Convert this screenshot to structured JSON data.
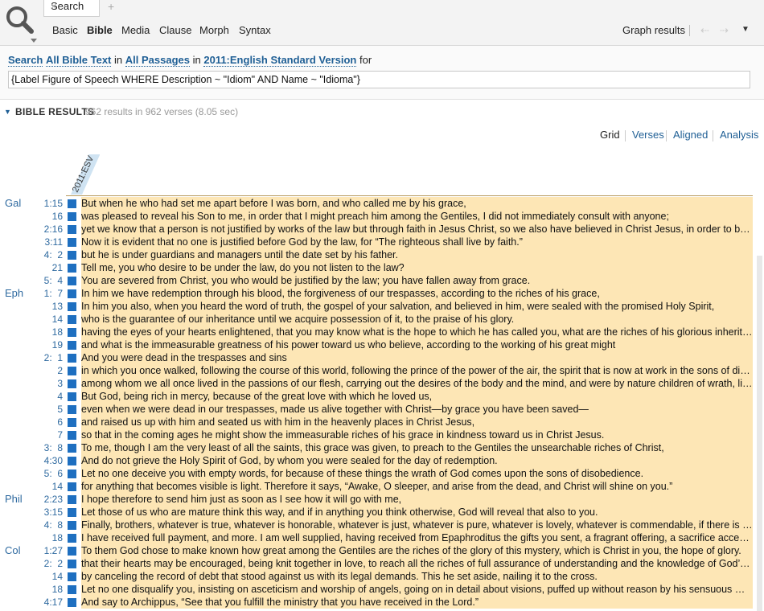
{
  "toolbar": {
    "tab_label": "Search",
    "tab_close": "×",
    "tab_add": "+",
    "modes": [
      "Basic",
      "Bible",
      "Media",
      "Clause",
      "Morph",
      "Syntax"
    ],
    "active_mode": "Bible",
    "graph_results": "Graph results",
    "back_arrow": "⇠",
    "forward_arrow": "⇢",
    "menu_arrow": "▼"
  },
  "query": {
    "search_word": "Search",
    "scope": "All Bible Text",
    "in1": "in",
    "passages": "All Passages",
    "in2": "in",
    "version": "2011:English Standard Version",
    "for": "for",
    "input_value": "{Label Figure of Speech WHERE Description ~ \"Idiom\" AND Name ~ \"Idioma\"}"
  },
  "results": {
    "title": "BIBLE RESULTS",
    "count": "962 results in 962 verses (8.05 sec)",
    "views": [
      "Grid",
      "Verses",
      "Aligned",
      "Analysis"
    ],
    "selected_view": "Grid",
    "column_header": "2011:ESV",
    "highlight_color": "#fde6b5",
    "marker_color": "#1e6fc0",
    "rows": [
      {
        "book": "Gal",
        "ref": "1:15",
        "text": "But when he who had set me apart before I was born, and who called me by his grace,"
      },
      {
        "book": "",
        "ref": "16",
        "text": "was pleased to reveal his Son to me, in order that I might preach him among the Gentiles, I did not immediately consult with anyone;"
      },
      {
        "book": "",
        "ref": "2:16",
        "text": "yet we know that a person is not justified by works of the law but through faith in Jesus Christ, so we also have believed in Christ Jesus, in order to be justified by faith in Christ"
      },
      {
        "book": "",
        "ref": "3:11",
        "text": "Now it is evident that no one is justified before God by the law, for “The righteous shall live by faith.”"
      },
      {
        "book": "",
        "ref": "4:  2",
        "text": "but he is under guardians and managers until the date set by his father."
      },
      {
        "book": "",
        "ref": "21",
        "text": "Tell me, you who desire to be under the law, do you not listen to the law?"
      },
      {
        "book": "",
        "ref": "5:  4",
        "text": "You are severed from Christ, you who would be justified by the law; you have fallen away from grace."
      },
      {
        "book": "Eph",
        "ref": "1:  7",
        "text": "In him we have redemption through his blood, the forgiveness of our trespasses, according to the riches of his grace,"
      },
      {
        "book": "",
        "ref": "13",
        "text": "In him you also, when you heard the word of truth, the gospel of your salvation, and believed in him, were sealed with the promised Holy Spirit,"
      },
      {
        "book": "",
        "ref": "14",
        "text": "who is the guarantee of our inheritance until we acquire possession of it, to the praise of his glory."
      },
      {
        "book": "",
        "ref": "18",
        "text": "having the eyes of your hearts enlightened, that you may know what is the hope to which he has called you, what are the riches of his glorious inheritance in the saints,"
      },
      {
        "book": "",
        "ref": "19",
        "text": "and what is the immeasurable greatness of his power toward us who believe, according to the working of his great might"
      },
      {
        "book": "",
        "ref": "2:  1",
        "text": "And you were dead in the trespasses and sins"
      },
      {
        "book": "",
        "ref": "2",
        "text": "in which you once walked, following the course of this world, following the prince of the power of the air, the spirit that is now at work in the sons of disobedience—"
      },
      {
        "book": "",
        "ref": "3",
        "text": "among whom we all once lived in the passions of our flesh, carrying out the desires of the body and the mind, and were by nature children of wrath, like the rest of mankind."
      },
      {
        "book": "",
        "ref": "4",
        "text": "But God, being rich in mercy, because of the great love with which he loved us,"
      },
      {
        "book": "",
        "ref": "5",
        "text": "even when we were dead in our trespasses, made us alive together with Christ—by grace you have been saved—"
      },
      {
        "book": "",
        "ref": "6",
        "text": "and raised us up with him and seated us with him in the heavenly places in Christ Jesus,"
      },
      {
        "book": "",
        "ref": "7",
        "text": "so that in the coming ages he might show the immeasurable riches of his grace in kindness toward us in Christ Jesus."
      },
      {
        "book": "",
        "ref": "3:  8",
        "text": "To me, though I am the very least of all the saints, this grace was given, to preach to the Gentiles the unsearchable riches of Christ,"
      },
      {
        "book": "",
        "ref": "4:30",
        "text": "And do not grieve the Holy Spirit of God, by whom you were sealed for the day of redemption."
      },
      {
        "book": "",
        "ref": "5:  6",
        "text": "Let no one deceive you with empty words, for because of these things the wrath of God comes upon the sons of disobedience."
      },
      {
        "book": "",
        "ref": "14",
        "text": "for anything that becomes visible is light. Therefore it says, “Awake, O sleeper, and arise from the dead, and Christ will shine on you.”"
      },
      {
        "book": "Phil",
        "ref": "2:23",
        "text": "I hope therefore to send him just as soon as I see how it will go with me,"
      },
      {
        "book": "",
        "ref": "3:15",
        "text": "Let those of us who are mature think this way, and if in anything you think otherwise, God will reveal that also to you."
      },
      {
        "book": "",
        "ref": "4:  8",
        "text": "Finally, brothers, whatever is true, whatever is honorable, whatever is just, whatever is pure, whatever is lovely, whatever is commendable, if there is any excellence,"
      },
      {
        "book": "",
        "ref": "18",
        "text": "I have received full payment, and more. I am well supplied, having received from Epaphroditus the gifts you sent, a fragrant offering, a sacrifice acceptable and pleasing to God."
      },
      {
        "book": "Col",
        "ref": "1:27",
        "text": "To them God chose to make known how great among the Gentiles are the riches of the glory of this mystery, which is Christ in you, the hope of glory."
      },
      {
        "book": "",
        "ref": "2:  2",
        "text": "that their hearts may be encouraged, being knit together in love, to reach all the riches of full assurance of understanding and the knowledge of God’s mystery, which is Christ,"
      },
      {
        "book": "",
        "ref": "14",
        "text": "by canceling the record of debt that stood against us with its legal demands. This he set aside, nailing it to the cross."
      },
      {
        "book": "",
        "ref": "18",
        "text": "Let no one disqualify you, insisting on asceticism and worship of angels, going on in detail about visions, puffed up without reason by his sensuous mind,"
      },
      {
        "book": "",
        "ref": "4:17",
        "text": "And say to Archippus, “See that you fulfill the ministry that you have received in the Lord.”"
      }
    ]
  }
}
